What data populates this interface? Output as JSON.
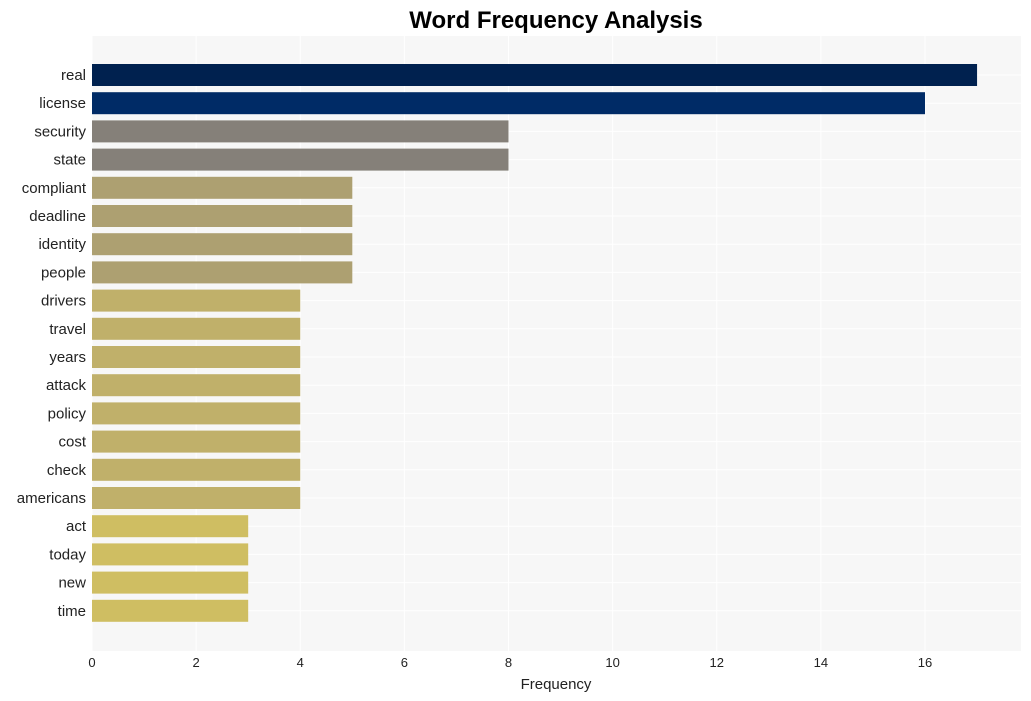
{
  "chart_data": {
    "type": "bar",
    "orientation": "horizontal",
    "title": "Word Frequency Analysis",
    "xlabel": "Frequency",
    "ylabel": "",
    "xlim": [
      0,
      17.9
    ],
    "xticks": [
      0,
      2,
      4,
      6,
      8,
      10,
      12,
      14,
      16
    ],
    "grid": true,
    "legend": "none",
    "categories": [
      "real",
      "license",
      "security",
      "state",
      "compliant",
      "deadline",
      "identity",
      "people",
      "drivers",
      "travel",
      "years",
      "attack",
      "policy",
      "cost",
      "check",
      "americans",
      "act",
      "today",
      "new",
      "time"
    ],
    "values": [
      17,
      16,
      8,
      8,
      5,
      5,
      5,
      5,
      4,
      4,
      4,
      4,
      4,
      4,
      4,
      4,
      3,
      3,
      3,
      3
    ],
    "colors": [
      "#00214f",
      "#002b66",
      "#858079",
      "#858079",
      "#ada071",
      "#ada071",
      "#ada071",
      "#ada071",
      "#c0b06a",
      "#c0b06a",
      "#c0b06a",
      "#c0b06a",
      "#c0b06a",
      "#c0b06a",
      "#c0b06a",
      "#c0b06a",
      "#cfbe62",
      "#cfbe62",
      "#cfbe62",
      "#cfbe62"
    ],
    "background": "#f7f7f7",
    "gridcolor": "#ffffff"
  }
}
